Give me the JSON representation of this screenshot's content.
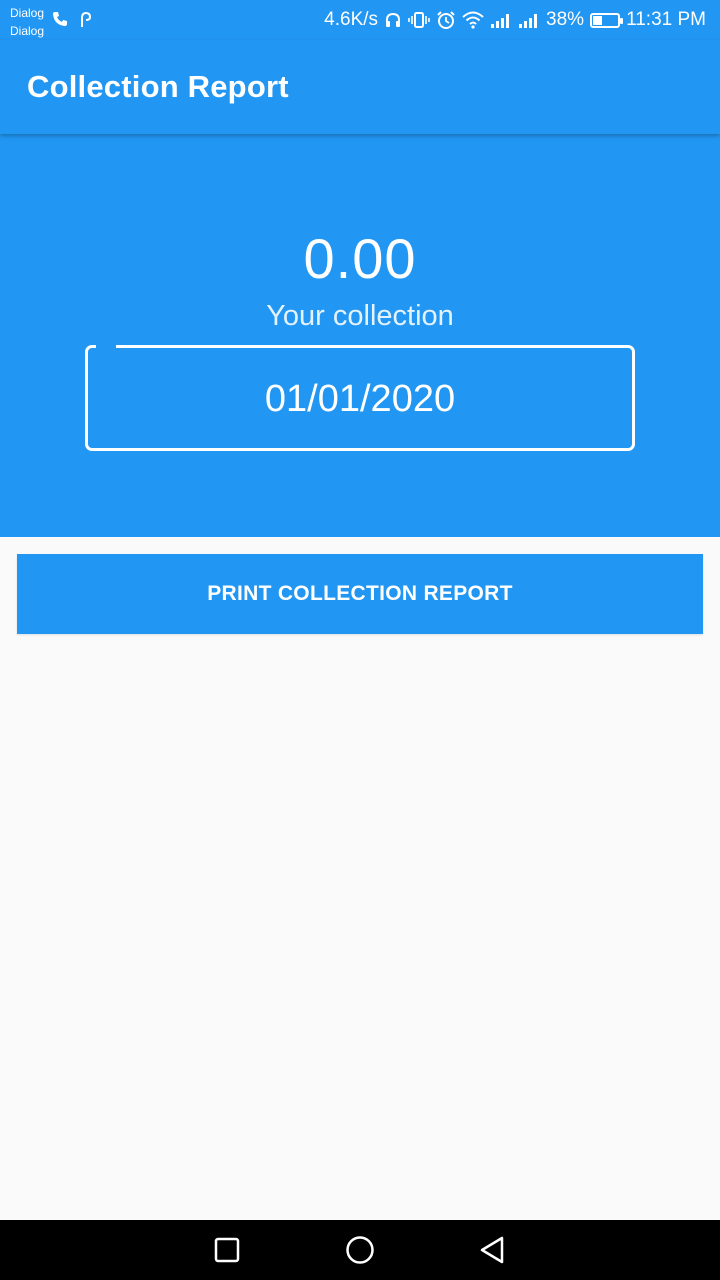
{
  "status_bar": {
    "carrier_1": "Dialog",
    "carrier_2": "Dialog",
    "network_speed": "4.6K/s",
    "battery_percent": "38%",
    "battery_level": 0.38,
    "time": "11:31 PM",
    "icons": [
      "phone-icon",
      "nfc-icon",
      "headphones-icon",
      "vibrate-icon",
      "alarm-icon",
      "wifi-icon",
      "signal-icon",
      "signal-icon",
      "battery-icon"
    ]
  },
  "app_bar": {
    "title": "Collection Report"
  },
  "summary": {
    "amount": "0.00",
    "label": "Your collection",
    "date": "01/01/2020"
  },
  "actions": {
    "print_label": "PRINT COLLECTION REPORT"
  },
  "nav_bar": {
    "icons": [
      "recents-icon",
      "home-icon",
      "back-icon"
    ]
  },
  "colors": {
    "primary": "#2196f3",
    "background": "#fafafa",
    "on_primary": "#ffffff"
  }
}
